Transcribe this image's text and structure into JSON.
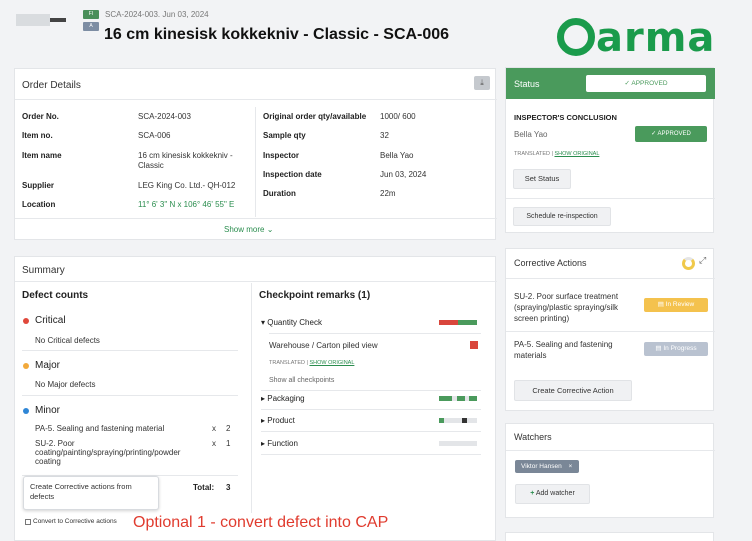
{
  "header": {
    "subtitle": "SCA-2024-003. Jun 03, 2024",
    "badge_f": "FI",
    "badge_a": "A",
    "title": "16 cm kinesisk kokkekniv - Classic - SCA-006",
    "logo": "arma"
  },
  "order_details": {
    "heading": "Order Details",
    "left": [
      {
        "label": "Order No.",
        "value": "SCA-2024-003"
      },
      {
        "label": "Item no.",
        "value": "SCA-006"
      },
      {
        "label": "Item name",
        "value": "16 cm kinesisk kokkekniv - Classic"
      },
      {
        "label": "Supplier",
        "value": "LEG King Co. Ltd.- QH-012"
      },
      {
        "label": "Location",
        "value": "11° 6' 3\" N x 106° 46' 55\" E"
      }
    ],
    "right": [
      {
        "label": "Original order qty/available",
        "value": "1000/ 600"
      },
      {
        "label": "Sample qty",
        "value": "32"
      },
      {
        "label": "Inspector",
        "value": "Bella Yao"
      },
      {
        "label": "Inspection date",
        "value": "Jun 03, 2024"
      },
      {
        "label": "Duration",
        "value": "22m"
      }
    ],
    "show_more": "Show more"
  },
  "summary": {
    "heading": "Summary",
    "defect_counts_title": "Defect counts",
    "critical": {
      "label": "Critical",
      "desc": "No Critical defects",
      "color": "#e0483b"
    },
    "major": {
      "label": "Major",
      "desc": "No Major defects",
      "color": "#f2a93b"
    },
    "minor": {
      "label": "Minor",
      "color": "#2f86d6",
      "items": [
        {
          "name": "PA-5. Sealing and fastening material",
          "x": "x",
          "qty": "2"
        },
        {
          "name": "SU-2. Poor coating/painting/spraying/printing/powder coating",
          "x": "x",
          "qty": "1"
        }
      ]
    },
    "total_label": "Total:",
    "total_value": "3",
    "tooltip": "Create Corrective actions from defects",
    "convert_label": "Convert to Corrective actions",
    "annotation": "Optional 1 - convert defect into CAP"
  },
  "checkpoints": {
    "heading": "Checkpoint remarks (1)",
    "quantity_check": "Quantity Check",
    "remark": "Warehouse / Carton piled view",
    "translated": "TRANSLATED",
    "show_original": "SHOW ORIGINAL",
    "show_all": "Show all checkpoints",
    "packaging": "Packaging",
    "product": "Product",
    "function": "Function"
  },
  "status": {
    "heading": "Status",
    "approved": "APPROVED",
    "conclusion_title": "INSPECTOR'S CONCLUSION",
    "inspector": "Bella Yao",
    "approved_small": "APPROVED",
    "translated": "TRANSLATED",
    "show_original": "SHOW ORIGINAL",
    "set_status": "Set Status",
    "schedule": "Schedule re-inspection"
  },
  "corrective": {
    "heading": "Corrective Actions",
    "items": [
      {
        "name": "SU-2. Poor surface treatment (spraying/plastic spraying/silk screen printing)",
        "status": "In Review"
      },
      {
        "name": "PA-5. Sealing and fastening materials",
        "status": "In Progress"
      }
    ],
    "create": "Create Corrective Action"
  },
  "watchers": {
    "heading": "Watchers",
    "tag": "Viktor Hansen",
    "tag_close": "×",
    "add": "Add watcher"
  },
  "colors": {
    "brand": "#1a9b4b",
    "status_header": "#4a9a5c"
  }
}
